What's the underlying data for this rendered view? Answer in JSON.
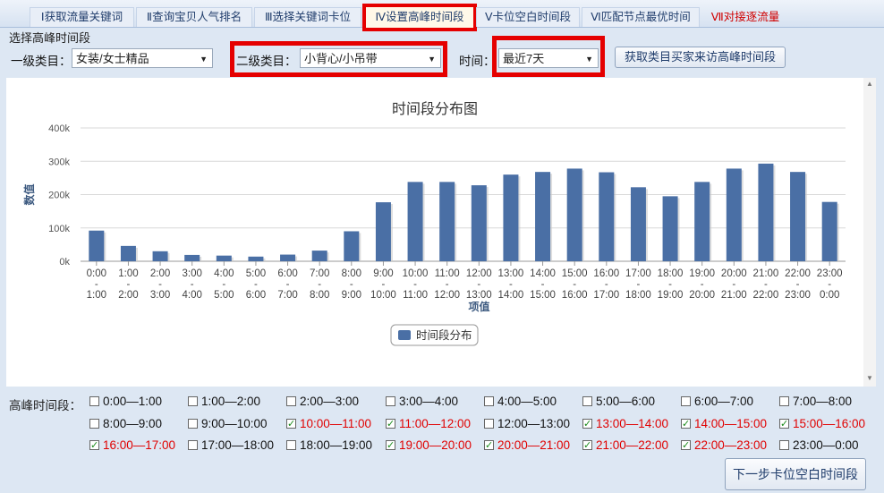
{
  "tabs": [
    {
      "label": "Ⅰ获取流量关键词",
      "state": "normal"
    },
    {
      "label": "Ⅱ查询宝贝人气排名",
      "state": "normal"
    },
    {
      "label": "Ⅲ选择关键词卡位",
      "state": "normal"
    },
    {
      "label": "Ⅳ设置高峰时间段",
      "state": "active"
    },
    {
      "label": "Ⅴ卡位空白时间段",
      "state": "normal"
    },
    {
      "label": "Ⅵ匹配节点最优时间",
      "state": "normal"
    },
    {
      "label": "Ⅶ对接逐流量",
      "state": "red"
    }
  ],
  "section_title": "选择高峰时间段",
  "filters": {
    "level1_label": "一级类目：",
    "level1_value": "女装/女士精品",
    "level2_label": "二级类目：",
    "level2_value": "小背心/小吊带",
    "time_label": "时间：",
    "time_value": "最近7天",
    "fetch_button": "获取类目买家来访高峰时间段"
  },
  "chart_data": {
    "type": "bar",
    "title": "时间段分布图",
    "xlabel": "项值",
    "ylabel": "数值",
    "ylim": [
      0,
      400000
    ],
    "yticks": [
      "0k",
      "100k",
      "200k",
      "300k",
      "400k"
    ],
    "categories": [
      "0:00 - 1:00",
      "1:00 - 2:00",
      "2:00 - 3:00",
      "3:00 - 4:00",
      "4:00 - 5:00",
      "5:00 - 6:00",
      "6:00 - 7:00",
      "7:00 - 8:00",
      "8:00 - 9:00",
      "9:00 - 10:00",
      "10:00 - 11:00",
      "11:00 - 12:00",
      "12:00 - 13:00",
      "13:00 - 14:00",
      "14:00 - 15:00",
      "15:00 - 16:00",
      "16:00 - 17:00",
      "17:00 - 18:00",
      "18:00 - 19:00",
      "19:00 - 20:00",
      "20:00 - 21:00",
      "21:00 - 22:00",
      "22:00 - 23:00",
      "23:00 - 0:00"
    ],
    "cat_top": [
      "0:00",
      "1:00",
      "2:00",
      "3:00",
      "4:00",
      "5:00",
      "6:00",
      "7:00",
      "8:00",
      "9:00",
      "10:00",
      "11:00",
      "12:00",
      "13:00",
      "14:00",
      "15:00",
      "16:00",
      "17:00",
      "18:00",
      "19:00",
      "20:00",
      "21:00",
      "22:00",
      "23:00"
    ],
    "cat_bottom": [
      "1:00",
      "2:00",
      "3:00",
      "4:00",
      "5:00",
      "6:00",
      "7:00",
      "8:00",
      "9:00",
      "10:00",
      "11:00",
      "12:00",
      "13:00",
      "14:00",
      "15:00",
      "16:00",
      "17:00",
      "18:00",
      "19:00",
      "20:00",
      "21:00",
      "22:00",
      "23:00",
      "0:00"
    ],
    "series": [
      {
        "name": "时间段分布",
        "values": [
          92000,
          46000,
          30000,
          19000,
          17000,
          14000,
          20000,
          32000,
          90000,
          177000,
          238000,
          238000,
          228000,
          260000,
          268000,
          278000,
          267000,
          222000,
          195000,
          238000,
          278000,
          293000,
          268000,
          178000
        ]
      }
    ],
    "bar_color": "#4a6fa5",
    "grid": true,
    "legend_position": "bottom-center"
  },
  "peak": {
    "label": "高峰时间段：",
    "slots": [
      {
        "label": "0:00—1:00",
        "checked": false
      },
      {
        "label": "1:00—2:00",
        "checked": false
      },
      {
        "label": "2:00—3:00",
        "checked": false
      },
      {
        "label": "3:00—4:00",
        "checked": false
      },
      {
        "label": "4:00—5:00",
        "checked": false
      },
      {
        "label": "5:00—6:00",
        "checked": false
      },
      {
        "label": "6:00—7:00",
        "checked": false
      },
      {
        "label": "7:00—8:00",
        "checked": false
      },
      {
        "label": "8:00—9:00",
        "checked": false
      },
      {
        "label": "9:00—10:00",
        "checked": false
      },
      {
        "label": "10:00—11:00",
        "checked": true
      },
      {
        "label": "11:00—12:00",
        "checked": true
      },
      {
        "label": "12:00—13:00",
        "checked": false
      },
      {
        "label": "13:00—14:00",
        "checked": true
      },
      {
        "label": "14:00—15:00",
        "checked": true
      },
      {
        "label": "15:00—16:00",
        "checked": true
      },
      {
        "label": "16:00—17:00",
        "checked": true
      },
      {
        "label": "17:00—18:00",
        "checked": false
      },
      {
        "label": "18:00—19:00",
        "checked": false
      },
      {
        "label": "19:00—20:00",
        "checked": true
      },
      {
        "label": "20:00—21:00",
        "checked": true
      },
      {
        "label": "21:00—22:00",
        "checked": true
      },
      {
        "label": "22:00—23:00",
        "checked": true
      },
      {
        "label": "23:00—0:00",
        "checked": false
      }
    ]
  },
  "next_button": "下一步卡位空白时间段"
}
